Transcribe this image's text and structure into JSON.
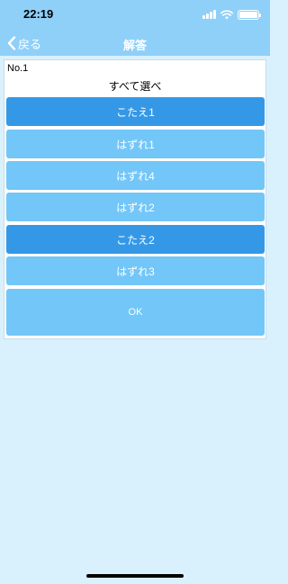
{
  "status_bar": {
    "time": "22:19"
  },
  "nav": {
    "back_label": "戻る",
    "title": "解答"
  },
  "question": {
    "number": "No.1",
    "prompt": "すべて選べ",
    "choices": [
      {
        "label": "こたえ1",
        "selected": true
      },
      {
        "label": "はずれ1",
        "selected": false
      },
      {
        "label": "はずれ4",
        "selected": false
      },
      {
        "label": "はずれ2",
        "selected": false
      },
      {
        "label": "こたえ2",
        "selected": true
      },
      {
        "label": "はずれ3",
        "selected": false
      }
    ],
    "ok_label": "OK"
  },
  "colors": {
    "bar": "#8fd0f8",
    "background": "#d9f0fd",
    "selected": "#3598e6",
    "unselected": "#72c6f8"
  }
}
